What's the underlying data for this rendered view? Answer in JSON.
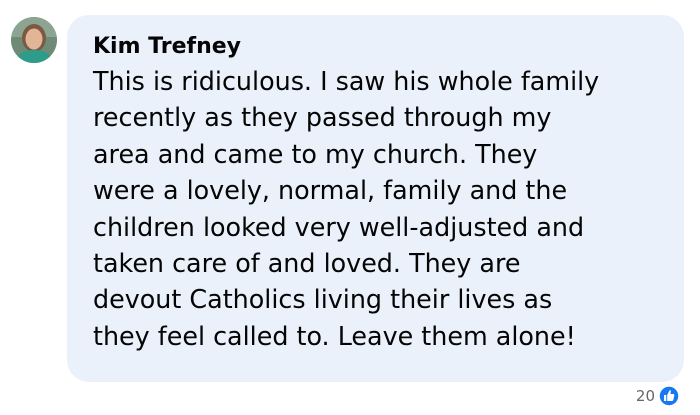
{
  "comment": {
    "author": "Kim Trefney",
    "avatar_icon": "profile-photo-avatar",
    "text_lines": [
      "This is ridiculous. I saw his whole family",
      "recently as they passed through my",
      "area and came to my church. They",
      "were a lovely, normal, family and the",
      "children looked very well-adjusted and",
      "taken care of and loved. They are",
      "devout Catholics living their lives as",
      "they feel called to. Leave them alone!"
    ],
    "reactions": {
      "count": "20",
      "icon": "like-icon",
      "color": "#1877f2"
    }
  },
  "colors": {
    "bubble_background": "#eaf1fb",
    "text": "#050505",
    "meta_text": "#65676b"
  }
}
